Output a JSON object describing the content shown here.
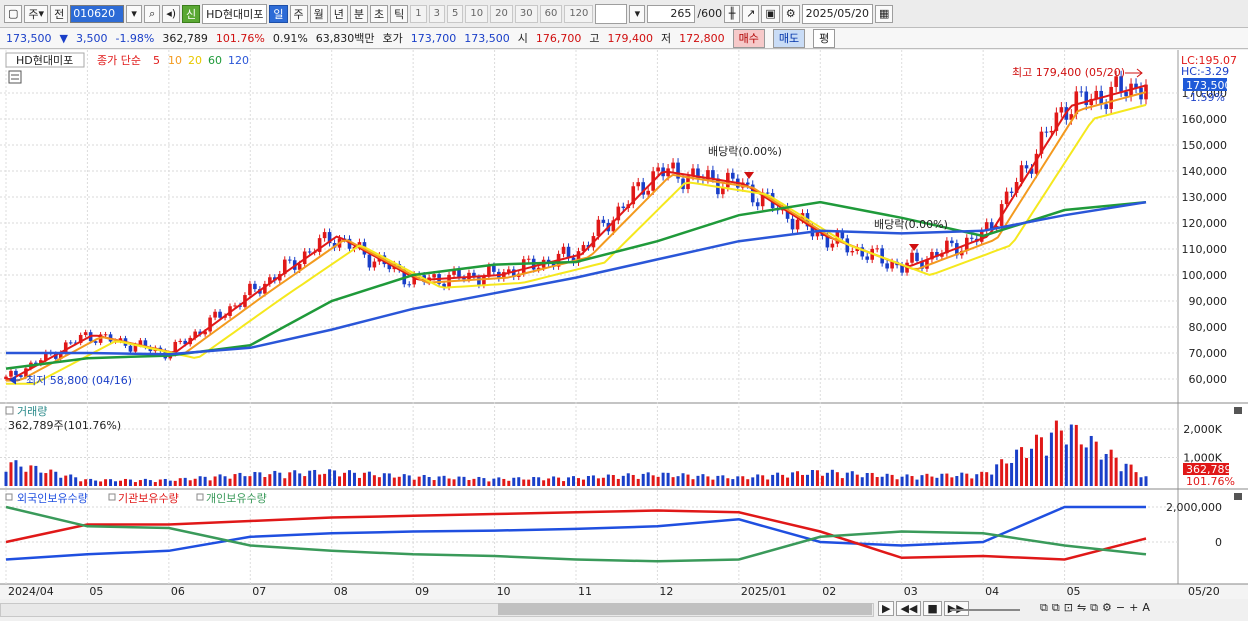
{
  "toolbar": {
    "type_select": "주",
    "prev_label": "전",
    "code": "010620",
    "stock_name": "HD현대미포",
    "credit_badge": "신",
    "periods": [
      "일",
      "주",
      "월",
      "년",
      "분",
      "초",
      "틱"
    ],
    "active_period": "일",
    "intervals": [
      "1",
      "3",
      "5",
      "10",
      "20",
      "30",
      "60",
      "120"
    ],
    "count_value": "265",
    "count_total": "/600",
    "date": "2025/05/20"
  },
  "infobar": {
    "price": "173,500",
    "change_arrow": "▼",
    "change": "3,500",
    "change_pct": "-1.98%",
    "volume": "362,789",
    "volume_ratio": "101.76%",
    "turnover": "0.91%",
    "amount": "63,830백만",
    "bid_label": "호가",
    "bid": "173,700",
    "ask": "173,500",
    "open_label": "시",
    "open": "176,700",
    "high_label": "고",
    "high": "179,400",
    "low_label": "저",
    "low": "172,800",
    "buy_label": "매수",
    "sell_label": "매도",
    "eval_label": "평"
  },
  "colors": {
    "up": "#e01818",
    "down": "#1a3fc8",
    "ma5": "#e01818",
    "ma10": "#f39a1e",
    "ma20": "#f5e81e",
    "ma60": "#1f9a3a",
    "ma120": "#2a56d8",
    "foreign": "#1f4fe0",
    "institution": "#e01818",
    "individual": "#3a9a5a"
  },
  "price_panel": {
    "stock_label": "HD현대미포",
    "ma_prefix": "종가 단순",
    "ma_periods": [
      "5",
      "10",
      "20",
      "60",
      "120"
    ],
    "lc_label": "LC:195.07",
    "hc_label": "HC:-3.29",
    "current_price_label": "173,500",
    "current_pct_label": "-1.59%",
    "max_label": "최고 179,400 (05/20)",
    "min_label": "최저 58,800 (04/16)",
    "dividend1_label": "배당락(0.00%)",
    "dividend2_label": "배당락(0.00%)",
    "y_ticks": [
      "60,000",
      "70,000",
      "80,000",
      "90,000",
      "100,000",
      "110,000",
      "120,000",
      "130,000",
      "140,000",
      "150,000",
      "160,000",
      "170,000"
    ]
  },
  "volume_panel": {
    "title": "거래량",
    "value_label": "362,789주(101.76%)",
    "y_ticks": [
      "1,000K",
      "2,000K"
    ],
    "current_label": "362,789",
    "current_pct": "101.76%"
  },
  "holding_panel": {
    "series_labels": [
      "외국인보유수량",
      "기관보유수량",
      "개인보유수량"
    ],
    "y_ticks": [
      "2,000,000",
      "0"
    ]
  },
  "x_axis": {
    "labels": [
      "2024/04",
      "05",
      "06",
      "07",
      "08",
      "09",
      "10",
      "11",
      "12",
      "2025/01",
      "02",
      "03",
      "04",
      "05",
      "05/20"
    ]
  },
  "chart_data": [
    {
      "type": "line",
      "title": "HD현대미포",
      "xlabel": "",
      "ylabel": "",
      "x": [
        "2024/04",
        "05",
        "06",
        "07",
        "08",
        "09",
        "10",
        "11",
        "12",
        "2025/01",
        "02",
        "03",
        "04",
        "05",
        "05/20"
      ],
      "ylim": [
        55000,
        195000
      ],
      "series": [
        {
          "name": "종가",
          "values": [
            60000,
            77000,
            70000,
            93000,
            115000,
            98000,
            100000,
            108000,
            140000,
            135000,
            115000,
            103000,
            115000,
            165000,
            173500
          ]
        },
        {
          "name": "60",
          "values": [
            64000,
            68000,
            69000,
            73000,
            90000,
            100000,
            104000,
            105000,
            113000,
            123000,
            128000,
            122000,
            115000,
            125000,
            128000
          ]
        },
        {
          "name": "120",
          "values": [
            70000,
            70000,
            69500,
            72000,
            79000,
            87000,
            93000,
            99000,
            106000,
            113000,
            117000,
            116000,
            117000,
            123000,
            128000
          ]
        }
      ],
      "annotations": [
        "최고 179,400 (05/20)",
        "최저 58,800 (04/16)",
        "배당락(0.00%)",
        "배당락(0.00%)"
      ],
      "legend": "top-left"
    },
    {
      "type": "bar",
      "title": "거래량",
      "categories": [
        "2024/04",
        "05",
        "06",
        "07",
        "08",
        "09",
        "10",
        "11",
        "12",
        "2025/01",
        "02",
        "03",
        "04",
        "05",
        "05/20"
      ],
      "values": [
        1000000,
        250000,
        250000,
        500000,
        600000,
        400000,
        300000,
        350000,
        500000,
        350000,
        600000,
        400000,
        500000,
        2500000,
        362789
      ],
      "ylim": [
        0,
        2600000
      ]
    },
    {
      "type": "line",
      "title": "",
      "x": [
        "2024/04",
        "05",
        "06",
        "07",
        "08",
        "09",
        "10",
        "11",
        "12",
        "2025/01",
        "02",
        "03",
        "04",
        "05",
        "05/20"
      ],
      "ylim": [
        -1200000,
        2600000
      ],
      "series": [
        {
          "name": "외국인보유수량",
          "values": [
            -1000000,
            -700000,
            -500000,
            300000,
            500000,
            600000,
            650000,
            750000,
            900000,
            1300000,
            0,
            -200000,
            0,
            2000000,
            2000000
          ]
        },
        {
          "name": "기관보유수량",
          "values": [
            0,
            1000000,
            1000000,
            1200000,
            1400000,
            1500000,
            1600000,
            1700000,
            1800000,
            1700000,
            600000,
            -900000,
            -800000,
            -1000000,
            200000
          ]
        },
        {
          "name": "개인보유수량",
          "values": [
            2000000,
            900000,
            800000,
            -200000,
            -500000,
            -700000,
            -800000,
            -1000000,
            -1100000,
            -1000000,
            300000,
            600000,
            500000,
            -200000,
            -700000
          ]
        }
      ]
    }
  ]
}
